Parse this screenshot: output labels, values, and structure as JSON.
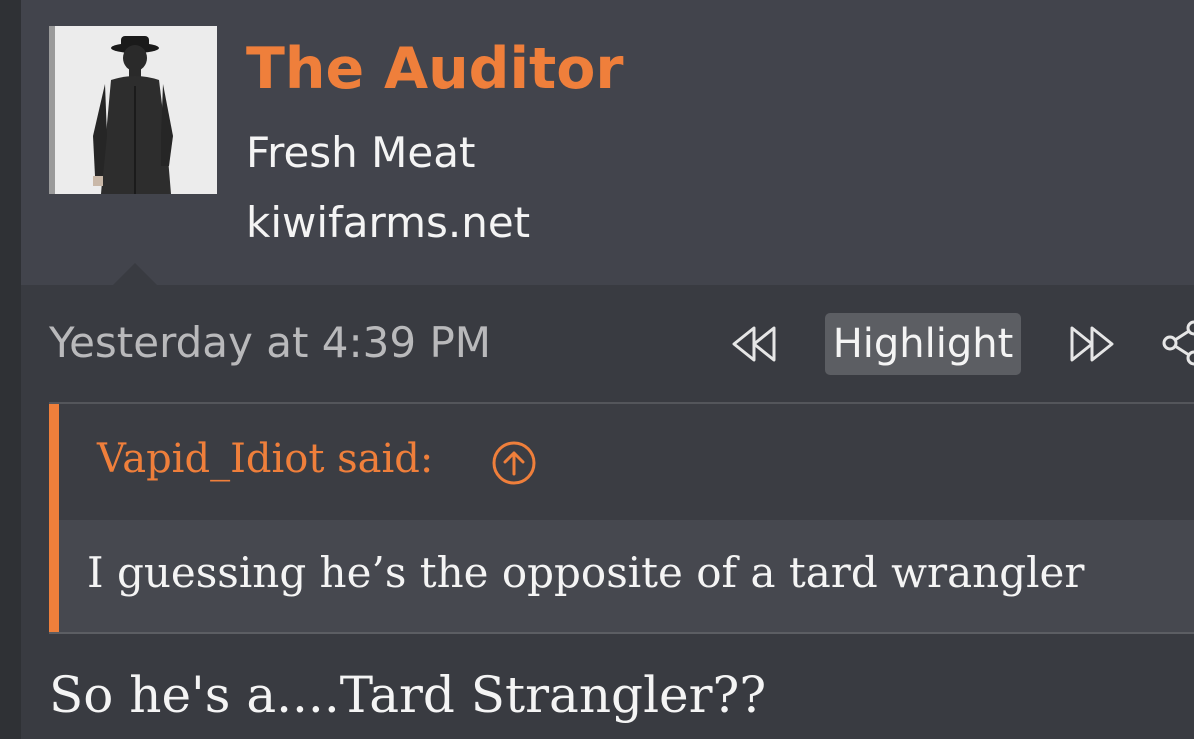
{
  "user": {
    "name": "The Auditor",
    "title": "Fresh Meat",
    "site": "kiwifarms.net",
    "avatar_icon": "avatar-man-in-hat-icon"
  },
  "post": {
    "timestamp": "Yesterday at 4:39 PM",
    "toolbar": {
      "prev_icon": "double-chevron-left-icon",
      "highlight_label": "Highlight",
      "next_icon": "double-chevron-right-icon",
      "share_icon": "share-icon"
    },
    "quote": {
      "author": "Vapid_Idiot said:",
      "jump_icon": "arrow-up-circle-icon",
      "text": "I guessing he’s the opposite of a tard wrangler"
    },
    "body": "So he's a....Tard Strangler??"
  },
  "colors": {
    "accent": "#ef7f3b",
    "header_bg": "#42444c",
    "page_bg": "#393b41",
    "text": "#f4f4f4",
    "muted": "#b9b9bb",
    "button_bg": "#5c5e63"
  }
}
